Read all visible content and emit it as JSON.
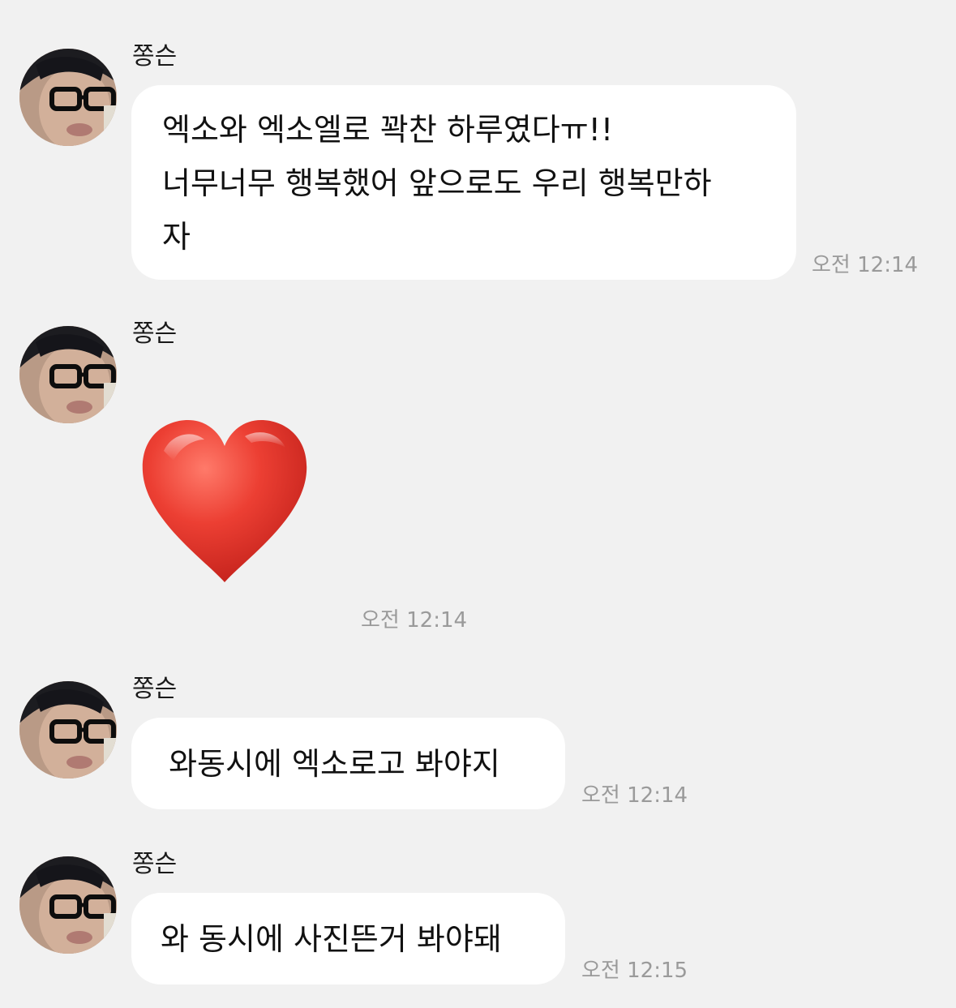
{
  "chat": {
    "messages": [
      {
        "sender": "쫑슨",
        "text": "엑소와 엑소엘로 꽉찬 하루였다ㅠ!!\n너무너무 행복했어 앞으로도 우리 행복만하\n자",
        "time": "오전 12:14"
      },
      {
        "sender": "쫑슨",
        "emoji": "red-heart",
        "time": "오전 12:14"
      },
      {
        "sender": "쫑슨",
        "text": " 와동시에 엑소로고 봐야지",
        "time": "오전 12:14"
      },
      {
        "sender": "쫑슨",
        "text": "와 동시에 사진뜬거 봐야돼",
        "time": "오전 12:15"
      }
    ]
  },
  "colors": {
    "background": "#f1f1f1",
    "bubble": "#ffffff",
    "timestamp": "#9a9a9a",
    "heart": "#e63b2e"
  },
  "icons": {
    "avatar": "profile-photo",
    "emoji": "red-heart-emoji"
  }
}
